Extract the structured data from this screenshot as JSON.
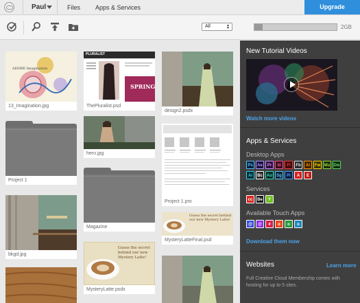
{
  "topnav": {
    "user": "Paul",
    "links": [
      "Files",
      "Apps & Services"
    ],
    "upgrade_label": "Upgrade"
  },
  "toolbar": {
    "filter_value": "All",
    "storage_label": "2GB",
    "storage_fraction": 0.1
  },
  "files": {
    "items": [
      {
        "label": "13_Imagination.jpg",
        "kind": "image"
      },
      {
        "label": "ThePluralist.psd",
        "kind": "image"
      },
      {
        "label": "design2.psdx",
        "kind": "image"
      },
      {
        "label": "Project 1",
        "kind": "folder"
      },
      {
        "label": "hero.jpg",
        "kind": "image"
      },
      {
        "label": "Project 1.pro",
        "kind": "document"
      },
      {
        "label": "bkgd.jpg",
        "kind": "image"
      },
      {
        "label": "Magazine",
        "kind": "folder"
      },
      {
        "label": "MysteryLatteFinal.psd",
        "kind": "image"
      },
      {
        "label": "MysteryLatte.psdx",
        "kind": "image"
      }
    ],
    "thumb_text": {
      "imagination": "ADOBE Imagination",
      "pluralist": "PLURALIST",
      "spring": "SPRING",
      "latte": "Guess the secret behind our new Mystery Latte!"
    }
  },
  "panel": {
    "tutorials_heading": "New Tutorial Videos",
    "watch_link": "Watch more videos",
    "apps_heading": "Apps & Services",
    "desktop_label": "Desktop Apps",
    "desktop_apps_row1": [
      {
        "abbr": "Ps",
        "bg": "#0b1e3a",
        "fg": "#4fc1ff"
      },
      {
        "abbr": "Ae",
        "bg": "#1e0e3a",
        "fg": "#a99bff"
      },
      {
        "abbr": "Pr",
        "bg": "#2a0e3a",
        "fg": "#d38cff"
      },
      {
        "abbr": "Id",
        "bg": "#3a0b1e",
        "fg": "#ff4f8a"
      },
      {
        "abbr": "Fl",
        "bg": "#3a0a0a",
        "fg": "#ff3333"
      },
      {
        "abbr": "Fb",
        "bg": "#2a2a2a",
        "fg": "#e0e0e0"
      },
      {
        "abbr": "Ai",
        "bg": "#3a2400",
        "fg": "#ff9a00"
      },
      {
        "abbr": "Fw",
        "bg": "#3a3300",
        "fg": "#ffd400"
      },
      {
        "abbr": "Mu",
        "bg": "#1a2a0a",
        "fg": "#8ddf3a"
      },
      {
        "abbr": "Dw",
        "bg": "#0e2a0e",
        "fg": "#5fd65f"
      }
    ],
    "desktop_apps_row2": [
      {
        "abbr": "Ai",
        "bg": "#0a2a33",
        "fg": "#2dd4e8"
      },
      {
        "abbr": "Bc",
        "bg": "#2a2a2a",
        "fg": "#ffffff"
      },
      {
        "abbr": "Au",
        "bg": "#0b2a2a",
        "fg": "#34e0b8"
      },
      {
        "abbr": "Sg",
        "bg": "#0a2233",
        "fg": "#5cc8ff"
      },
      {
        "abbr": "Pl",
        "bg": "#0a1e3a",
        "fg": "#4a9aff"
      },
      {
        "abbr": "A",
        "bg": "#d81e1e",
        "fg": "#ffffff"
      },
      {
        "abbr": "E",
        "bg": "#c41818",
        "fg": "#ffffff"
      }
    ],
    "services_label": "Services",
    "services": [
      {
        "abbr": "cc",
        "bg": "#d8261e",
        "fg": "#ffffff"
      },
      {
        "abbr": "Be",
        "bg": "#1a1a1a",
        "fg": "#ffffff"
      },
      {
        "abbr": "Y",
        "bg": "#6fbf1f",
        "fg": "#ffffff"
      }
    ],
    "touch_label": "Available Touch Apps",
    "touch_apps": [
      {
        "abbr": "@",
        "bg": "#3a4fd8",
        "fg": "#ffffff"
      },
      {
        "abbr": "@",
        "bg": "#8a2be2",
        "fg": "#ffffff"
      },
      {
        "abbr": "#",
        "bg": "#d81e4a",
        "fg": "#ffffff"
      },
      {
        "abbr": "o",
        "bg": "#e84a1e",
        "fg": "#ffffff"
      },
      {
        "abbr": "o",
        "bg": "#2a9a3a",
        "fg": "#ffffff"
      },
      {
        "abbr": "o",
        "bg": "#1e8ab8",
        "fg": "#ffffff"
      }
    ],
    "download_link": "Download them now",
    "websites_heading": "Websites",
    "learn_more": "Learn more",
    "websites_text": "Full Creative Cloud Membership comes with hosting for up to 5 sites."
  },
  "colors": {
    "accent": "#2f8fdc",
    "link": "#4da3e8",
    "panel_bg": "#3f3f3f"
  }
}
